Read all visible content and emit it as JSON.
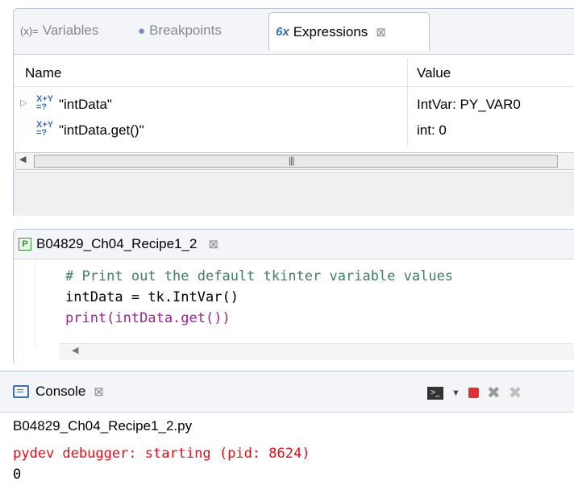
{
  "expressions_panel": {
    "tabs": [
      {
        "icon": "(x)=",
        "label": "Variables"
      },
      {
        "icon": "●",
        "label": "Breakpoints"
      },
      {
        "icon": "6x",
        "label": "Expressions"
      }
    ],
    "columns": {
      "name": "Name",
      "value": "Value"
    },
    "rows": [
      {
        "name": "\"intData\"",
        "value": "IntVar: PY_VAR0",
        "expandable": true
      },
      {
        "name": "\"intData.get()\"",
        "value": "int: 0",
        "expandable": false
      }
    ]
  },
  "editor": {
    "tab_label": "B04829_Ch04_Recipe1_2",
    "code_lines": [
      "# Print out the default tkinter variable values",
      "intData = tk.IntVar()",
      "print(intData.get())"
    ]
  },
  "console": {
    "tab_label": "Console",
    "process_name": "B04829_Ch04_Recipe1_2.py",
    "output": [
      "pydev debugger: starting (pid: 8624)",
      "0"
    ]
  },
  "colors": {
    "accent": "#3b6fb6",
    "error": "#e0101a",
    "keyword": "#7f0055",
    "comment": "#3f7f5f",
    "builtin": "#9b2393"
  }
}
